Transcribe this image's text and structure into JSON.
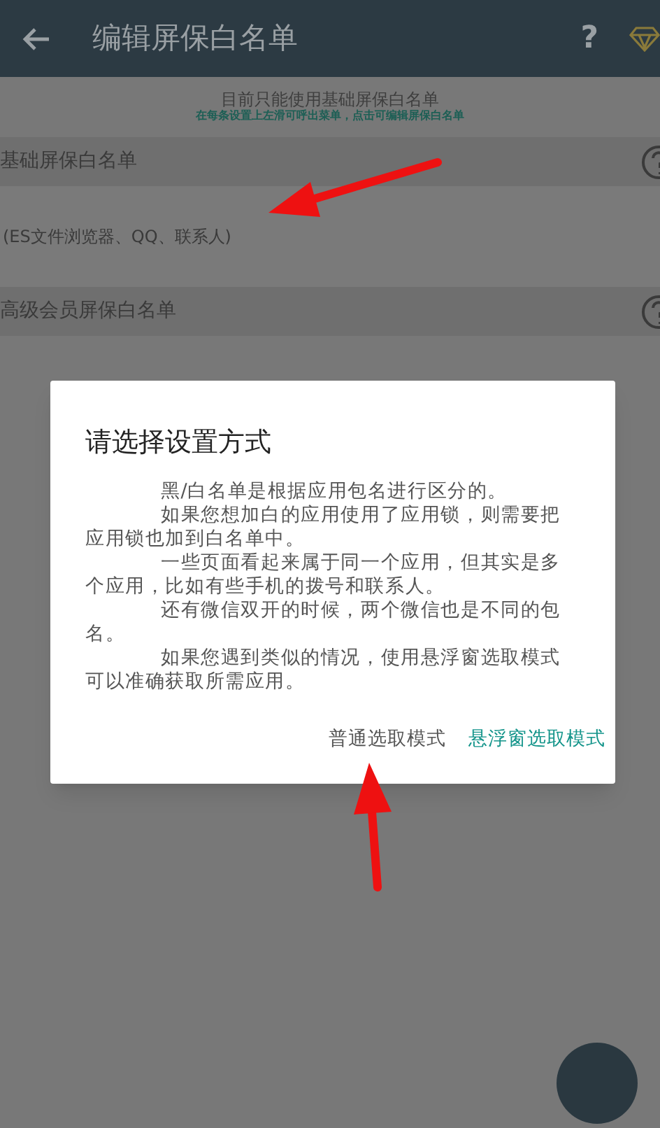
{
  "header": {
    "title": "编辑屏保白名单",
    "help": "?"
  },
  "notice": {
    "line": "目前只能使用基础屏保白名单",
    "hint": "在每条设置上左滑可呼出菜单，点击可编辑屏保白名单"
  },
  "sections": [
    {
      "title": "基础屏保白名单",
      "items": [
        "(ES文件浏览器、QQ、联系人)"
      ]
    },
    {
      "title": "高级会员屏保白名单"
    }
  ],
  "dialog": {
    "title": "请选择设置方式",
    "paragraphs": [
      "黑/白名单是根据应用包名进行区分的。",
      "如果您想加白的应用使用了应用锁，则需要把应用锁也加到白名单中。",
      "一些页面看起来属于同一个应用，但其实是多个应用，比如有些手机的拨号和联系人。",
      "还有微信双开的时候，两个微信也是不同的包名。",
      "如果您遇到类似的情况，使用悬浮窗选取模式可以准确获取所需应用。"
    ],
    "buttons": [
      {
        "label": "普通选取模式",
        "kind": "plain"
      },
      {
        "label": "悬浮窗选取模式",
        "kind": "accent"
      }
    ]
  }
}
